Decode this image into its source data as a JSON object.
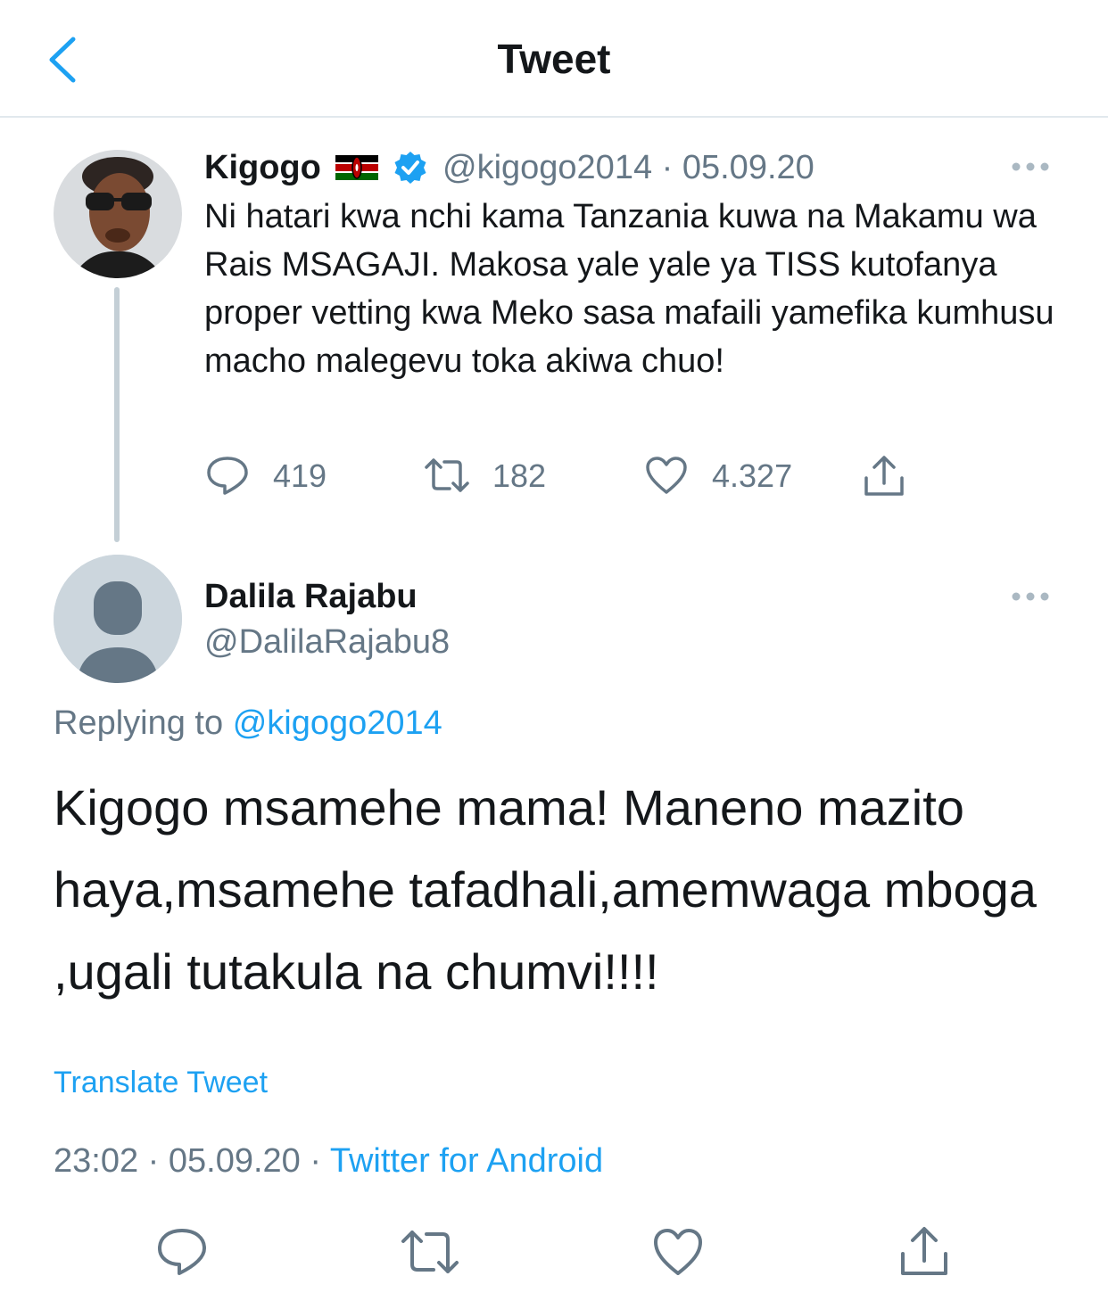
{
  "header": {
    "title": "Tweet",
    "back_icon": "chevron-left-icon"
  },
  "parent_tweet": {
    "name": "Kigogo",
    "handle": "@kigogo2014",
    "date": "05.09.20",
    "handle_date": "@kigogo2014 · 05.09.20",
    "text": "Ni hatari kwa nchi kama Tanzania kuwa na Makamu wa Rais MSAGAJI. Makosa yale yale ya TISS kutofanya proper vetting kwa  Meko sasa mafaili yamefika kumhusu macho malegevu toka akiwa chuo!",
    "replies": "419",
    "retweets": "182",
    "likes": "4.327"
  },
  "tweet": {
    "name": "Dalila Rajabu",
    "handle": "@DalilaRajabu8",
    "replying_label": "Replying to",
    "replying_to": "@kigogo2014",
    "text": "Kigogo msamehe mama! Maneno mazito haya,msamehe tafadhali,amemwaga mboga ,ugali tutakula na chumvi!!!!",
    "translate_label": "Translate Tweet",
    "time_date": "23:02 · 05.09.20 · ",
    "source": "Twitter for Android"
  },
  "colors": {
    "accent": "#1da1f2",
    "secondary_text": "#657786",
    "primary_text": "#14171a",
    "divider": "#e1e8ed"
  }
}
